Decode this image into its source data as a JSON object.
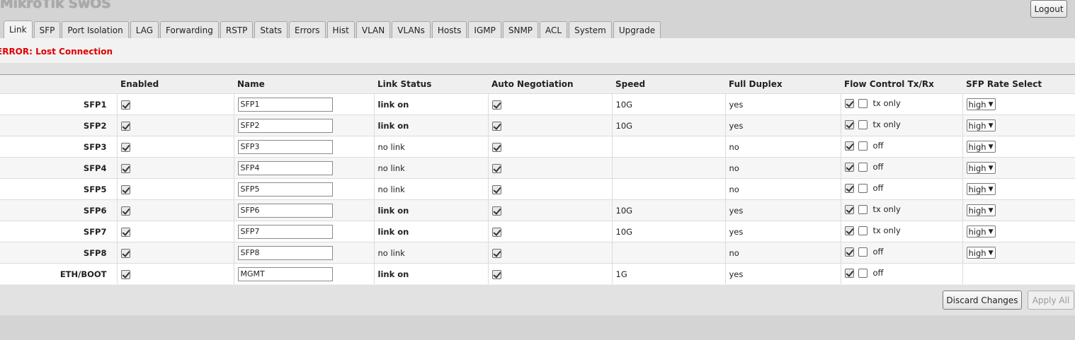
{
  "app": {
    "title": "MikroTik SwOS",
    "logout_label": "Logout"
  },
  "tabs": [
    "Link",
    "SFP",
    "Port Isolation",
    "LAG",
    "Forwarding",
    "RSTP",
    "Stats",
    "Errors",
    "Hist",
    "VLAN",
    "VLANs",
    "Hosts",
    "IGMP",
    "SNMP",
    "ACL",
    "System",
    "Upgrade"
  ],
  "active_tab": "Link",
  "error_message": "ERROR: Lost Connection",
  "table": {
    "headers": [
      "",
      "Enabled",
      "Name",
      "Link Status",
      "Auto Negotiation",
      "Speed",
      "Full Duplex",
      "Flow Control Tx/Rx",
      "SFP Rate Select"
    ],
    "rows": [
      {
        "port": "SFP1",
        "enabled": true,
        "name": "SFP1",
        "link_status": "link on",
        "auto_negotiation": true,
        "speed": "10G",
        "full_duplex": "yes",
        "flow_tx": true,
        "flow_rx": false,
        "flow_label": "tx only",
        "rate_select": "high"
      },
      {
        "port": "SFP2",
        "enabled": true,
        "name": "SFP2",
        "link_status": "link on",
        "auto_negotiation": true,
        "speed": "10G",
        "full_duplex": "yes",
        "flow_tx": true,
        "flow_rx": false,
        "flow_label": "tx only",
        "rate_select": "high"
      },
      {
        "port": "SFP3",
        "enabled": true,
        "name": "SFP3",
        "link_status": "no link",
        "auto_negotiation": true,
        "speed": "",
        "full_duplex": "no",
        "flow_tx": true,
        "flow_rx": false,
        "flow_label": "off",
        "rate_select": "high"
      },
      {
        "port": "SFP4",
        "enabled": true,
        "name": "SFP4",
        "link_status": "no link",
        "auto_negotiation": true,
        "speed": "",
        "full_duplex": "no",
        "flow_tx": true,
        "flow_rx": false,
        "flow_label": "off",
        "rate_select": "high"
      },
      {
        "port": "SFP5",
        "enabled": true,
        "name": "SFP5",
        "link_status": "no link",
        "auto_negotiation": true,
        "speed": "",
        "full_duplex": "no",
        "flow_tx": true,
        "flow_rx": false,
        "flow_label": "off",
        "rate_select": "high"
      },
      {
        "port": "SFP6",
        "enabled": true,
        "name": "SFP6",
        "link_status": "link on",
        "auto_negotiation": true,
        "speed": "10G",
        "full_duplex": "yes",
        "flow_tx": true,
        "flow_rx": false,
        "flow_label": "tx only",
        "rate_select": "high"
      },
      {
        "port": "SFP7",
        "enabled": true,
        "name": "SFP7",
        "link_status": "link on",
        "auto_negotiation": true,
        "speed": "10G",
        "full_duplex": "yes",
        "flow_tx": true,
        "flow_rx": false,
        "flow_label": "tx only",
        "rate_select": "high"
      },
      {
        "port": "SFP8",
        "enabled": true,
        "name": "SFP8",
        "link_status": "no link",
        "auto_negotiation": true,
        "speed": "",
        "full_duplex": "no",
        "flow_tx": true,
        "flow_rx": false,
        "flow_label": "off",
        "rate_select": "high"
      },
      {
        "port": "ETH/BOOT",
        "enabled": true,
        "name": "MGMT",
        "link_status": "link on",
        "auto_negotiation": true,
        "speed": "1G",
        "full_duplex": "yes",
        "flow_tx": true,
        "flow_rx": false,
        "flow_label": "off",
        "rate_select": ""
      }
    ]
  },
  "actions": {
    "discard_label": "Discard Changes",
    "apply_label": "Apply All"
  },
  "icons": {
    "checkbox_checked": "checkbox-checked-icon",
    "checkbox_unchecked": "checkbox-unchecked-icon",
    "dropdown": "chevron-down-icon"
  },
  "colors": {
    "error": "#e00000",
    "background": "#d4d4d4"
  }
}
